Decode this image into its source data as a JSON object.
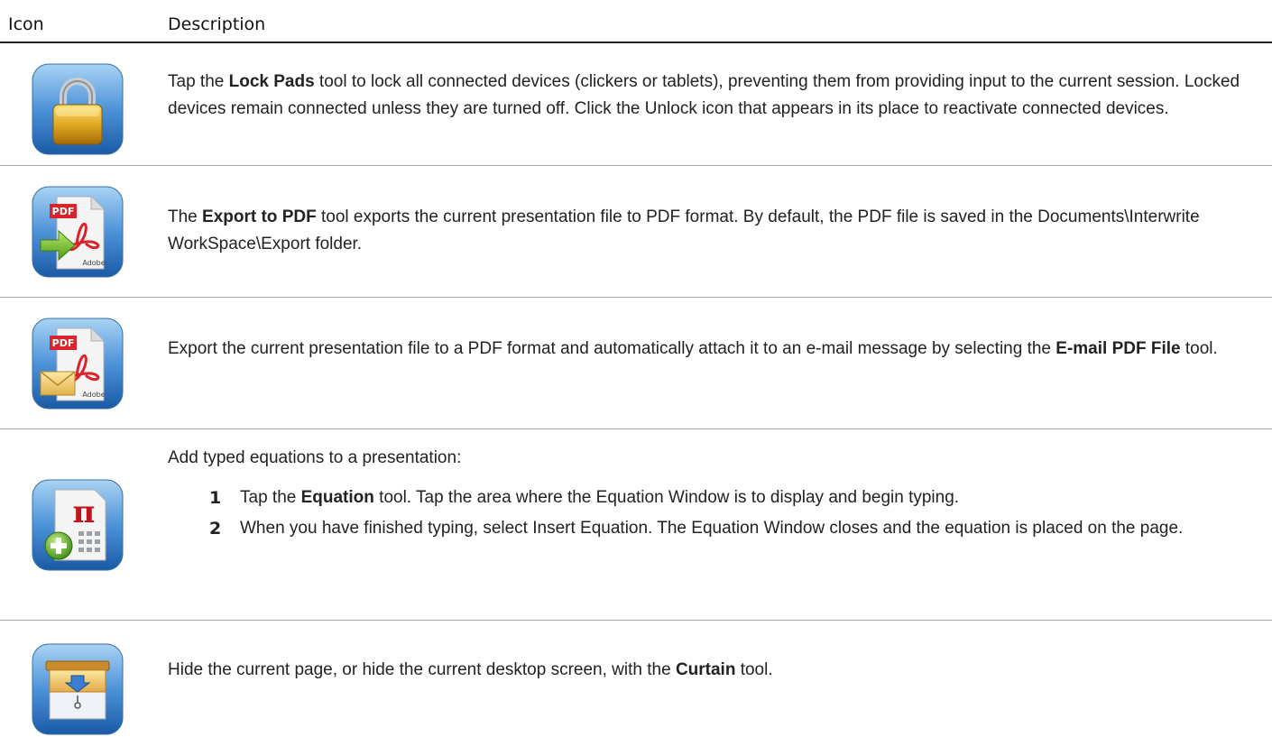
{
  "header": {
    "icon_col": "Icon",
    "desc_col": "Description"
  },
  "rows": [
    {
      "icon": "lock-pads-icon",
      "parts": [
        "Tap the ",
        "Lock Pads",
        " tool to lock all connected devices (clickers or tablets), preventing them from providing input to the current session. Locked devices remain connected unless they are turned off. Click the Unlock icon that appears in its place to reactivate connected devices."
      ]
    },
    {
      "icon": "export-pdf-icon",
      "parts": [
        "The ",
        "Export to PDF",
        " tool exports the current presentation file to PDF format. By default, the PDF file is saved in the Documents\\Interwrite WorkSpace\\Export folder."
      ]
    },
    {
      "icon": "email-pdf-icon",
      "parts": [
        "Export the current presentation file to a PDF format and automatically attach it to an e-mail message by selecting the ",
        "E-mail PDF File",
        " tool."
      ]
    },
    {
      "icon": "equation-icon",
      "intro": "Add typed equations to a presentation:",
      "steps": [
        {
          "num": "1",
          "parts": [
            "Tap the ",
            "Equation",
            " tool. Tap the area where the Equation Window is to display and begin typing."
          ]
        },
        {
          "num": "2",
          "text": "When you have finished typing, select Insert Equation. The Equation Window closes and the equation is placed on the page."
        }
      ]
    },
    {
      "icon": "curtain-icon",
      "parts": [
        "Hide the current page, or hide the current desktop screen, with the ",
        "Curtain",
        " tool."
      ]
    }
  ],
  "icon_labels": {
    "pdf": "PDF",
    "adobe": "Adobe",
    "pi": "π"
  },
  "colors": {
    "icon_blue_top": "#8ec3ee",
    "icon_blue_bottom": "#1f64b0",
    "lock_gold": "#d9a21a",
    "pdf_red": "#d8242b"
  }
}
